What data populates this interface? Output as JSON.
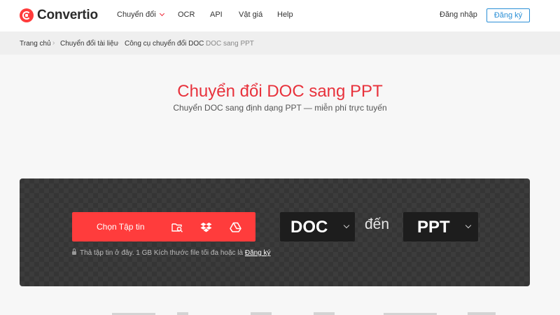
{
  "header": {
    "brand": "Convertio",
    "nav": [
      {
        "label": "Chuyển đổi",
        "dropdown": true
      },
      {
        "label": "OCR"
      },
      {
        "label": "API"
      },
      {
        "label": "Vật giá"
      },
      {
        "label": "Help"
      }
    ],
    "login_label": "Đăng nhập",
    "signup_label": "Đăng ký"
  },
  "breadcrumb": [
    "Trang chủ",
    "Chuyển đổi tài liệu",
    "Công cụ chuyển đổi DOC",
    "DOC sang PPT"
  ],
  "hero": {
    "title": "Chuyển đổi DOC sang PPT",
    "subtitle": "Chuyển DOC sang định dạng PPT — miễn phí trực tuyến"
  },
  "converter": {
    "choose_label": "Chọn Tập tin",
    "sources": [
      "folder-search-icon",
      "dropbox-icon",
      "google-drive-icon"
    ],
    "hint_text": "Thả tập tin ở đây. 1 GB Kích thước file tối đa hoặc là",
    "hint_link": "Đăng ký",
    "from_format": "DOC",
    "to_word": "đến",
    "to_format": "PPT"
  },
  "colors": {
    "accent": "#ff3c3c",
    "title": "#e8323c",
    "link_blue": "#2a8fd6",
    "panel": "#353535",
    "select_bg": "#1d1d1d"
  }
}
